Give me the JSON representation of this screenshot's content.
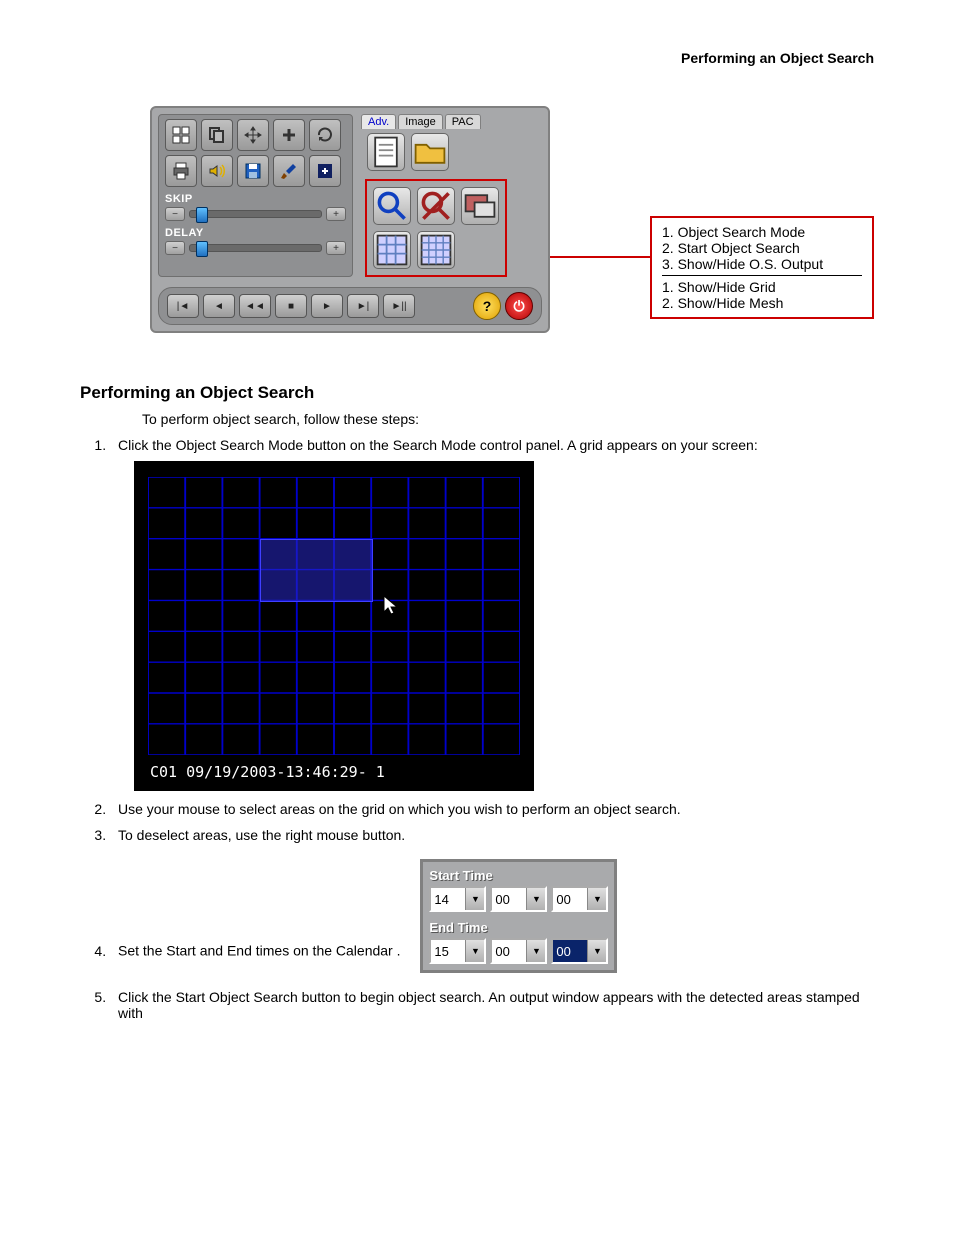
{
  "header": {
    "title": "Performing an Object Search"
  },
  "panel": {
    "tabs": [
      "Adv.",
      "Image",
      "PAC"
    ],
    "labels": {
      "skip": "SKIP",
      "delay": "DELAY"
    }
  },
  "callout": {
    "group1": [
      "1. Object Search Mode",
      "2. Start Object Search",
      "3. Show/Hide O.S. Output"
    ],
    "group2": [
      "1. Show/Hide Grid",
      "2. Show/Hide Mesh"
    ]
  },
  "section": {
    "heading": "Performing an Object Search",
    "intro": "To perform object search, follow these steps:",
    "steps": [
      "Click the Object Search Mode button on the Search Mode control panel. A grid appears on your screen:",
      "Use your mouse to select areas on the grid on which you wish to perform an object search.",
      "To deselect areas, use the right mouse button.",
      "Set the Start and End times on the Calendar .",
      "Click the Start Object Search button to begin object search. An output window appears with the detected areas stamped with"
    ]
  },
  "grid": {
    "footer": "C01 09/19/2003-13:46:29- 1"
  },
  "time": {
    "start_label": "Start Time",
    "end_label": "End Time",
    "start": [
      "14",
      "00",
      "00"
    ],
    "end": [
      "15",
      "00",
      "00"
    ]
  }
}
